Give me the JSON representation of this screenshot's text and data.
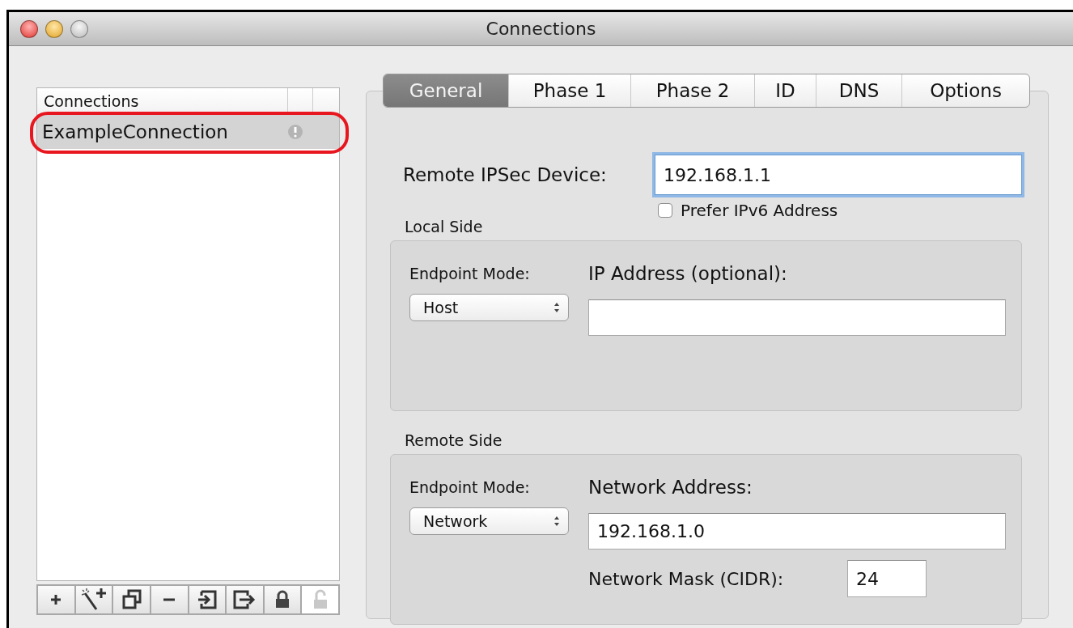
{
  "window": {
    "title": "Connections"
  },
  "connections": {
    "header": "Connections",
    "items": [
      {
        "name": "ExampleConnection",
        "selected": true,
        "annotated": true,
        "warning": true
      }
    ]
  },
  "toolbar": [
    {
      "kind": "add",
      "disabled": false
    },
    {
      "kind": "wizard",
      "disabled": false
    },
    {
      "kind": "duplicate",
      "disabled": false
    },
    {
      "kind": "remove",
      "disabled": false
    },
    {
      "kind": "import",
      "disabled": false
    },
    {
      "kind": "export",
      "disabled": false
    },
    {
      "kind": "lock",
      "disabled": false
    },
    {
      "kind": "unlock",
      "disabled": true
    }
  ],
  "tabs": [
    {
      "label": "General",
      "selected": true
    },
    {
      "label": "Phase 1",
      "selected": false
    },
    {
      "label": "Phase 2",
      "selected": false
    },
    {
      "label": "ID",
      "selected": false
    },
    {
      "label": "DNS",
      "selected": false
    },
    {
      "label": "Options",
      "selected": false
    }
  ],
  "general": {
    "remote_device": {
      "label": "Remote IPSec Device:",
      "value": "192.168.1.1",
      "focused": true
    },
    "prefer_ipv6": {
      "label": "Prefer IPv6 Address",
      "checked": false
    },
    "local_side": {
      "title": "Local Side",
      "endpoint_label": "Endpoint Mode:",
      "endpoint_mode": "Host",
      "address_label": "IP Address (optional):"
    },
    "remote_side": {
      "title": "Remote Side",
      "endpoint_label": "Endpoint Mode:",
      "endpoint_mode": "Network",
      "address_label": "Network Address:",
      "address_value": "192.168.1.0",
      "mask_label": "Network Mask (CIDR):",
      "mask_value": "24"
    }
  }
}
